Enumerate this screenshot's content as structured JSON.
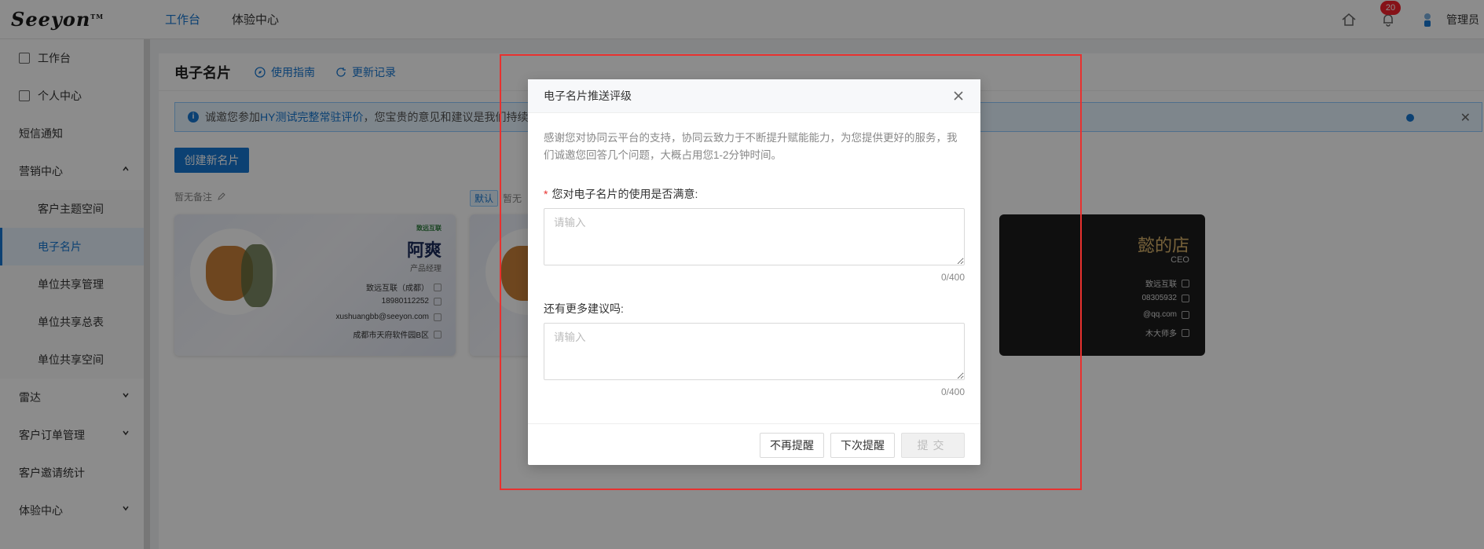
{
  "header": {
    "logo_text": "Seeyon",
    "logo_mark": "TM",
    "nav": [
      {
        "label": "工作台",
        "active": true
      },
      {
        "label": "体验中心",
        "active": false
      }
    ],
    "notification_count": "20",
    "user_name": "管理员"
  },
  "sidebar": {
    "items": [
      {
        "label": "工作台"
      },
      {
        "label": "个人中心"
      },
      {
        "label": "短信通知"
      },
      {
        "label": "营销中心"
      },
      {
        "label": "客户主题空间"
      },
      {
        "label": "电子名片"
      },
      {
        "label": "单位共享管理"
      },
      {
        "label": "单位共享总表"
      },
      {
        "label": "单位共享空间"
      },
      {
        "label": "雷达"
      },
      {
        "label": "客户订单管理"
      },
      {
        "label": "客户邀请统计"
      },
      {
        "label": "体验中心"
      }
    ]
  },
  "page": {
    "title": "电子名片",
    "guide_link": "使用指南",
    "changelog_link": "更新记录",
    "notice_prefix": "诚邀您参加",
    "notice_link": "HY测试完整常驻评价",
    "notice_suffix": "，您宝贵的意见和建议是我们持续",
    "create_button": "创建新名片",
    "card1_note": "暂无备注",
    "card2_tag": "默认",
    "card2_note": "暂无"
  },
  "cards": {
    "c1": {
      "logo": "致远互联",
      "name": "阿爽",
      "role": "产品经理",
      "company": "致远互联（成都）",
      "phone": "18980112252",
      "email": "xushuangbb@seeyon.com",
      "address": "成都市天府软件园B区"
    },
    "dark": {
      "title": "懿的店",
      "role": "CEO",
      "company": "致远互联",
      "phone": "08305932",
      "email": "@qq.com",
      "address": "木大师多"
    }
  },
  "modal": {
    "title": "电子名片推送评级",
    "intro": "感谢您对协同云平台的支持，协同云致力于不断提升赋能能力，为您提供更好的服务，我们诚邀您回答几个问题，大概占用您1-2分钟时间。",
    "q1_required": "*",
    "q1_label": "您对电子名片的使用是否满意:",
    "q1_placeholder": "请输入",
    "q1_counter": "0/400",
    "q2_label": "还有更多建议吗:",
    "q2_placeholder": "请输入",
    "q2_counter": "0/400",
    "btn_never": "不再提醒",
    "btn_later": "下次提醒",
    "btn_submit": "提交"
  },
  "colors": {
    "accent": "#1677d2",
    "highlight_frame": "#e8312f"
  }
}
